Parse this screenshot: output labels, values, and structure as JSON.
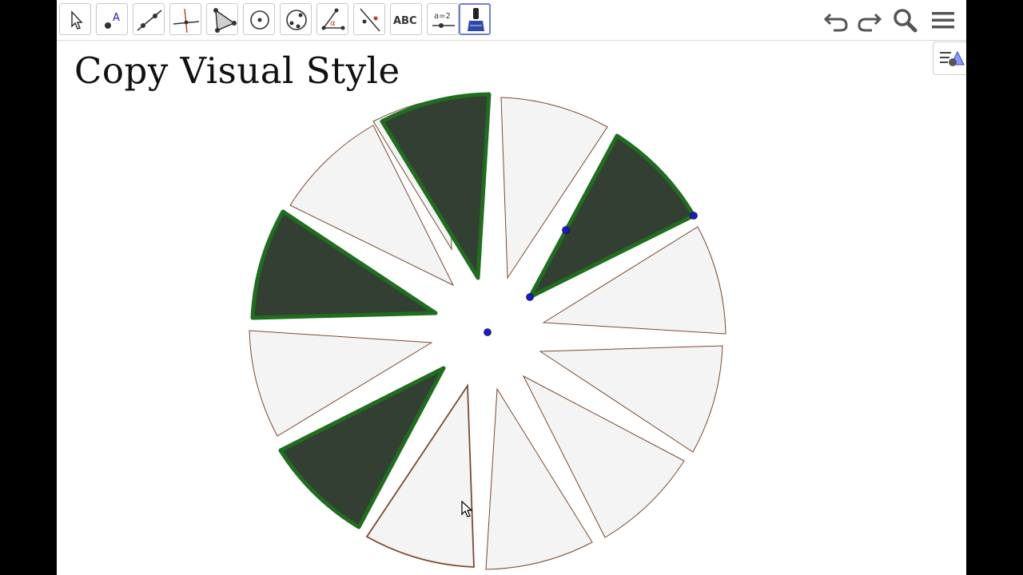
{
  "app": {
    "title": "Copy Visual Style"
  },
  "toolbar": {
    "tools": [
      {
        "name": "move-tool",
        "icon": "arrow-cursor-icon"
      },
      {
        "name": "point-tool",
        "icon": "point-icon",
        "glyph": "A"
      },
      {
        "name": "line-tool",
        "icon": "line-icon"
      },
      {
        "name": "perpendicular-line-tool",
        "icon": "perpendicular-icon"
      },
      {
        "name": "polygon-tool",
        "icon": "polygon-icon"
      },
      {
        "name": "circle-tool",
        "icon": "circle-icon"
      },
      {
        "name": "conic-tool",
        "icon": "ellipse-icon"
      },
      {
        "name": "angle-tool",
        "icon": "angle-icon",
        "glyph": "α"
      },
      {
        "name": "reflect-tool",
        "icon": "reflect-icon"
      },
      {
        "name": "text-tool",
        "icon": "text-icon",
        "label": "ABC"
      },
      {
        "name": "slider-tool",
        "icon": "slider-icon",
        "label": "a=2"
      },
      {
        "name": "copy-visual-style-tool",
        "icon": "brush-icon",
        "active": true
      }
    ],
    "right": [
      "undo-icon",
      "redo-icon",
      "search-icon",
      "menu-icon"
    ]
  },
  "colors": {
    "selected_fill": "#333f33",
    "selected_stroke": "#1e6e1e",
    "plain_fill": "#f4f4f4",
    "plain_stroke": "#7a4a30",
    "point": "#1a1acc",
    "active_tool_border": "#6c7fd6"
  },
  "figure": {
    "center_point": "point-center",
    "sectors": [
      {
        "id": 1,
        "selected": false
      },
      {
        "id": 2,
        "selected": true
      },
      {
        "id": 3,
        "selected": false
      },
      {
        "id": 4,
        "selected": true
      },
      {
        "id": 5,
        "selected": false
      },
      {
        "id": 6,
        "selected": false
      },
      {
        "id": 7,
        "selected": false
      },
      {
        "id": 8,
        "selected": false
      },
      {
        "id": 9,
        "selected": false
      },
      {
        "id": 10,
        "selected": false
      },
      {
        "id": 11,
        "selected": true
      },
      {
        "id": 12,
        "selected": false
      },
      {
        "id": 13,
        "selected": true
      },
      {
        "id": 14,
        "selected": false
      }
    ]
  }
}
